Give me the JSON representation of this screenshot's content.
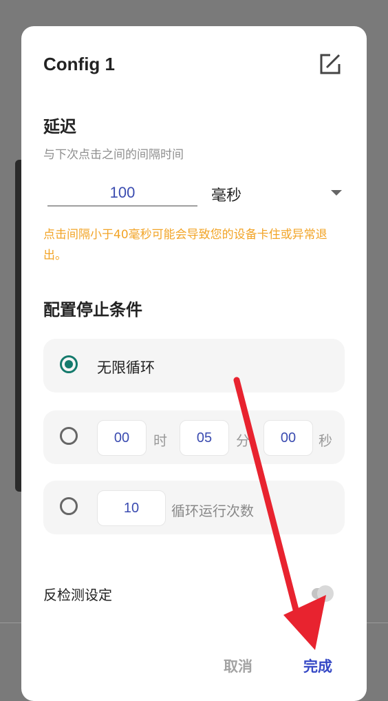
{
  "dialog": {
    "title": "Config 1",
    "delay": {
      "heading": "延迟",
      "subtitle": "与下次点击之间的间隔时间",
      "value": "100",
      "unit": "毫秒",
      "warning": "点击间隔小于40毫秒可能会导致您的设备卡住或异常退出。"
    },
    "stop": {
      "heading": "配置停止条件",
      "infinite_label": "无限循环",
      "timer": {
        "hours": "00",
        "hours_unit": "时",
        "minutes": "05",
        "minutes_unit": "分",
        "seconds": "00",
        "seconds_unit": "秒"
      },
      "count": {
        "value": "10",
        "label": "循环运行次数"
      }
    },
    "anti_detect_label": "反检测设定",
    "buttons": {
      "cancel": "取消",
      "done": "完成"
    }
  },
  "colors": {
    "accent": "#147a6c",
    "primary": "#3548c5",
    "warning": "#f2a427",
    "annotation_arrow": "#e8232f"
  }
}
